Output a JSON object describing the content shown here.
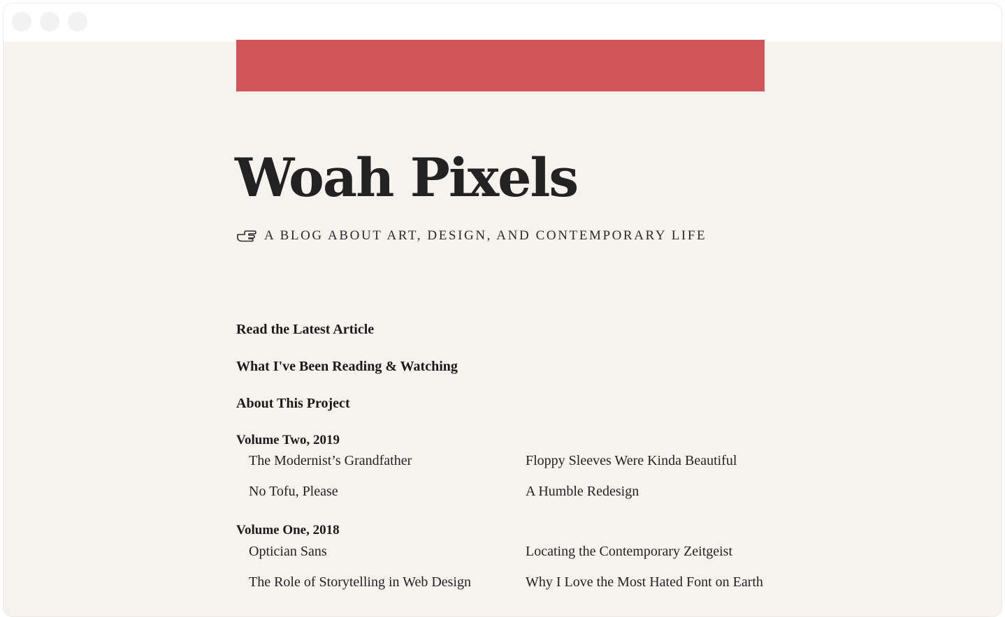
{
  "banner": {
    "color": "#d25557"
  },
  "site": {
    "title": "Woah Pixels",
    "tagline_icon": "pointing-hand-icon",
    "tagline": "A BLOG ABOUT ART, DESIGN, AND CONTEMPORARY LIFE"
  },
  "nav": {
    "items": [
      {
        "label": "Read the Latest Article"
      },
      {
        "label": "What I've Been Reading & Watching"
      },
      {
        "label": "About This Project"
      }
    ]
  },
  "volumes": [
    {
      "heading": "Volume Two, 2019",
      "articles": [
        "The Modernist’s Grandfather",
        "Floppy Sleeves Were Kinda Beautiful",
        "No Tofu, Please",
        "A Humble Redesign"
      ]
    },
    {
      "heading": "Volume One, 2018",
      "articles": [
        "Optician Sans",
        "Locating the Contemporary Zeitgeist",
        "The Role of Storytelling in Web Design",
        "Why I Love the Most Hated Font on Earth"
      ]
    }
  ],
  "colors": {
    "page_background": "#f6f3ee",
    "text": "#1f1f1f"
  }
}
